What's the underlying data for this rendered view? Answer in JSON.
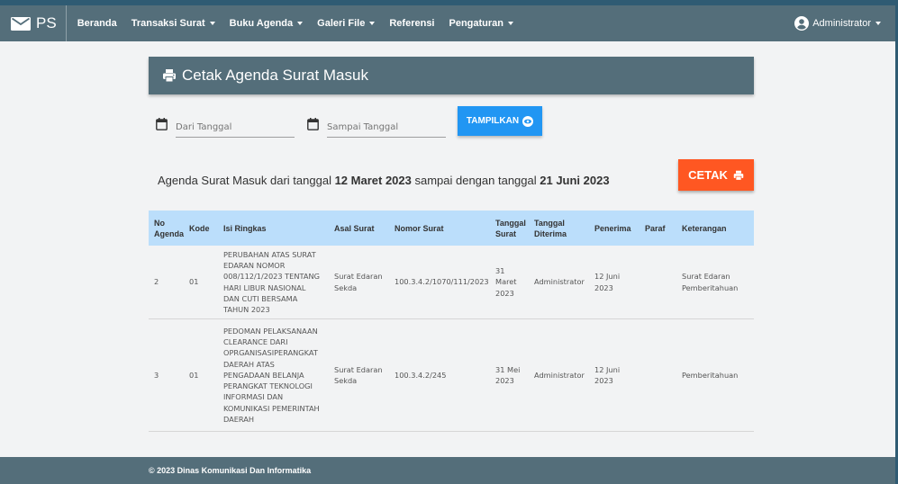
{
  "navbar": {
    "brand": "PS",
    "items": [
      {
        "label": "Beranda",
        "dropdown": false
      },
      {
        "label": "Transaksi Surat",
        "dropdown": true
      },
      {
        "label": "Buku Agenda",
        "dropdown": true
      },
      {
        "label": "Galeri File",
        "dropdown": true
      },
      {
        "label": "Referensi",
        "dropdown": false
      },
      {
        "label": "Pengaturan",
        "dropdown": true
      }
    ],
    "user": "Administrator"
  },
  "page": {
    "title": "Cetak Agenda Surat Masuk"
  },
  "filters": {
    "from_placeholder": "Dari Tanggal",
    "to_placeholder": "Sampai Tanggal",
    "show_button": "TAMPILKAN"
  },
  "summary": {
    "prefix": "Agenda Surat Masuk dari tanggal ",
    "from": "12 Maret 2023",
    "middle": " sampai dengan tanggal ",
    "to": "21 Juni 2023"
  },
  "print_button": "CETAK",
  "table": {
    "headers": [
      "No Agenda",
      "Kode",
      "Isi Ringkas",
      "Asal Surat",
      "Nomor Surat",
      "Tanggal Surat",
      "Tanggal Diterima",
      "Penerima",
      "Paraf",
      "Keterangan"
    ],
    "rows": [
      [
        "2",
        "01",
        "PERUBAHAN ATAS SURAT EDARAN NOMOR 008/112/1/2023 TENTANG HARI LIBUR NASIONAL DAN CUTI BERSAMA TAHUN 2023",
        "Surat Edaran Sekda",
        "100.3.4.2/1070/111/2023",
        "31 Maret 2023",
        "Administrator",
        "12 Juni 2023",
        "",
        "Surat Edaran Pemberitahuan"
      ],
      [
        "3",
        "01",
        "PEDOMAN PELAKSANAAN CLEARANCE DARI OPRGANISASIPERANGKAT DAERAH ATAS PENGADAAN BELANJA PERANGKAT TEKNOLOGI INFORMASI DAN KOMUNIKASI PEMERINTAH DAERAH",
        "Surat Edaran Sekda",
        "100.3.4.2/245",
        "31 Mei 2023",
        "Administrator",
        "12 Juni 2023",
        "",
        "Pemberitahuan"
      ]
    ]
  },
  "footer": {
    "text": "© 2023 Dinas Komunikasi Dan Informatika"
  },
  "colors": {
    "navbar": "#546e7a",
    "primary_button": "#2196f3",
    "print_button": "#ff5722",
    "table_header": "#bbdefb"
  },
  "icons": [
    "mail-icon",
    "account-circle-icon",
    "printer-icon",
    "calendar-icon",
    "eye-icon"
  ]
}
